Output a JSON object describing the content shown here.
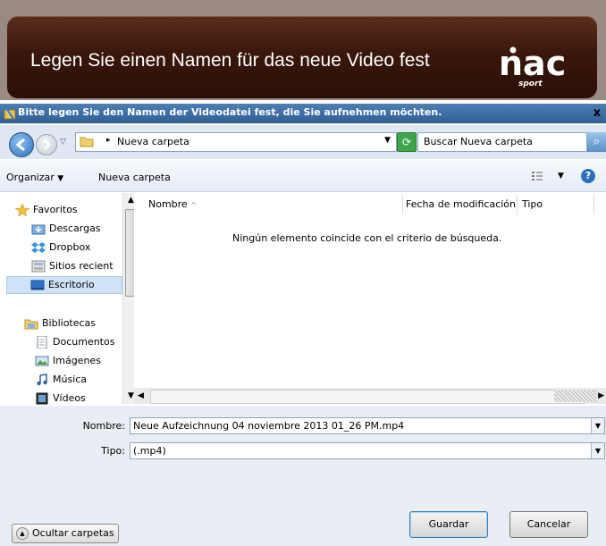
{
  "banner": {
    "title": "Legen Sie einen Namen für das neue Video fest",
    "logo_text": "nac",
    "logo_sub": "sport"
  },
  "dialog": {
    "title": "Bitte legen Sie den Namen der Videodatei fest, die Sie aufnehmen möchten.",
    "close": "x"
  },
  "address": {
    "path": "Nueva carpeta",
    "search_placeholder": "Buscar Nueva carpeta"
  },
  "toolbar": {
    "organize": "Organizar",
    "new_folder": "Nueva carpeta"
  },
  "nav": {
    "favorites": "Favoritos",
    "items": [
      "Descargas",
      "Dropbox",
      "Sitios recient",
      "Escritorio"
    ],
    "libraries": "Bibliotecas",
    "lib_items": [
      "Documentos",
      "Imágenes",
      "Música",
      "Vídeos"
    ]
  },
  "columns": {
    "name": "Nombre",
    "modified": "Fecha de modificación",
    "type": "Tipo"
  },
  "content": {
    "empty_message": "Ningún elemento coincide con el criterio de búsqueda."
  },
  "form": {
    "name_label": "Nombre:",
    "name_value": "Neue Aufzeichnung 04 noviembre 2013 01_26 PM.mp4",
    "type_label": "Tipo:",
    "type_value": "(.mp4)"
  },
  "buttons": {
    "hide_folders": "Ocultar carpetas",
    "save": "Guardar",
    "cancel": "Cancelar"
  },
  "colors": {
    "banner": "#3a170b",
    "titlebar": "#3d6fa4",
    "accent": "#2d6fb8"
  }
}
